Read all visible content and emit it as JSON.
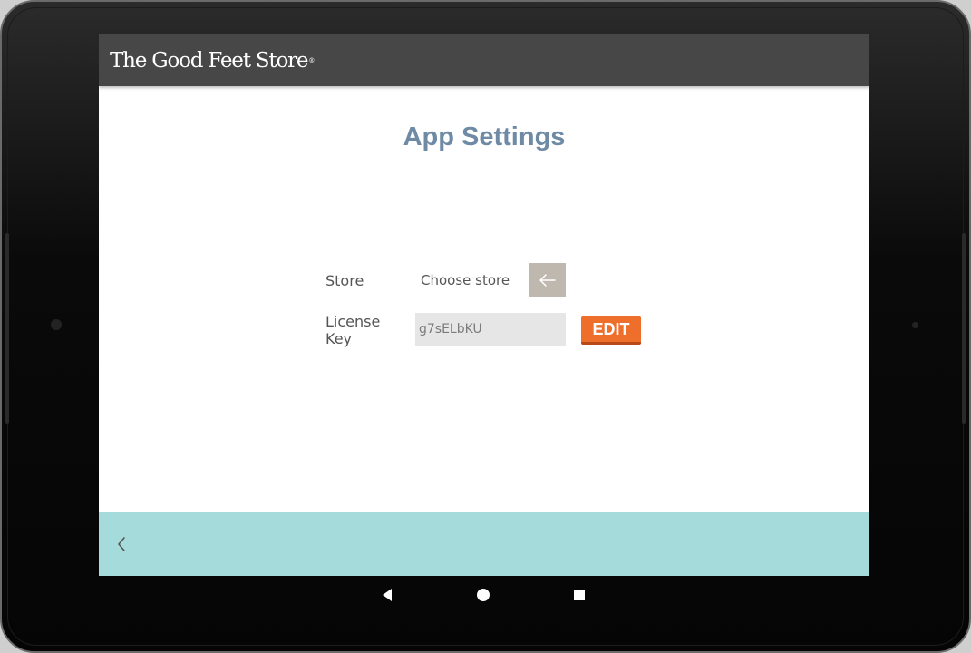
{
  "app": {
    "brand_name": "The Good Feet Store",
    "brand_mark": "®"
  },
  "page": {
    "title": "App Settings"
  },
  "form": {
    "store_label": "Store",
    "store_value": "Choose store",
    "store_button_icon": "arrow-left-icon",
    "license_label_line1": "License",
    "license_label_line2": "Key",
    "license_value": "g7sELbKU",
    "edit_label": "EDIT"
  },
  "bottom_bar": {
    "back_icon": "chevron-left-icon"
  },
  "system_nav": {
    "back_icon": "triangle-back-icon",
    "home_icon": "circle-home-icon",
    "recents_icon": "square-recents-icon"
  },
  "colors": {
    "topbar": "#474747",
    "title": "#6f8aa5",
    "edit_button": "#ee6e2c",
    "store_button": "#bfb8ae",
    "bottom_bar": "#a5dbdb"
  }
}
